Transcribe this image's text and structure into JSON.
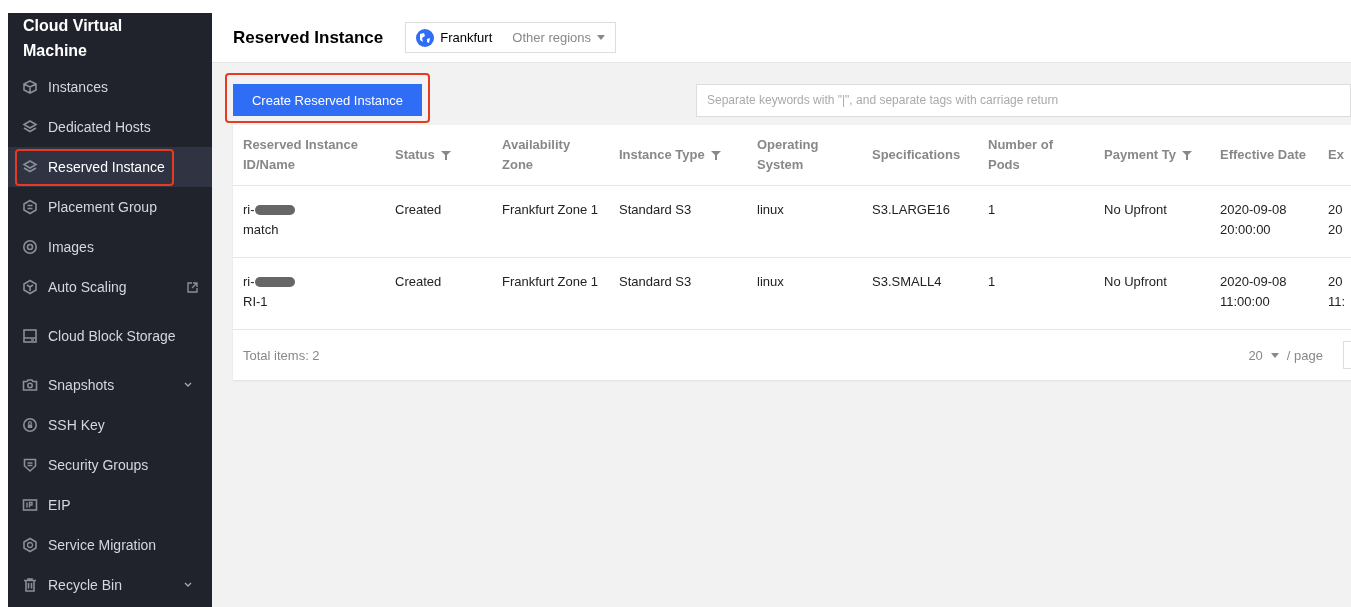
{
  "sidebar": {
    "title": "Cloud Virtual Machine",
    "items": [
      {
        "label": "Instances",
        "selected": false
      },
      {
        "label": "Dedicated Hosts",
        "selected": false
      },
      {
        "label": "Reserved Instance",
        "selected": true,
        "highlighted": true
      },
      {
        "label": "Placement Group",
        "selected": false
      },
      {
        "label": "Images",
        "selected": false
      },
      {
        "label": "Auto Scaling",
        "selected": false,
        "external": true
      },
      {
        "label": "Cloud Block Storage",
        "selected": false
      },
      {
        "label": "Snapshots",
        "selected": false,
        "expandable": true
      },
      {
        "label": "SSH Key",
        "selected": false
      },
      {
        "label": "Security Groups",
        "selected": false
      },
      {
        "label": "EIP",
        "selected": false
      },
      {
        "label": "Service Migration",
        "selected": false
      },
      {
        "label": "Recycle Bin",
        "selected": false,
        "expandable": true
      }
    ]
  },
  "header": {
    "title": "Reserved Instance",
    "region": "Frankfurt",
    "other_regions": "Other regions"
  },
  "toolbar": {
    "create_button": {
      "label": "Create Reserved Instance",
      "highlighted": true
    },
    "search": {
      "placeholder": "Separate keywords with \"|\", and separate tags with carriage return"
    }
  },
  "table": {
    "columns": [
      {
        "label": "Reserved Instance ID/Name",
        "filter": false
      },
      {
        "label": "Status",
        "filter": true
      },
      {
        "label": "Availability Zone",
        "filter": false
      },
      {
        "label": "Instance Type",
        "filter": true
      },
      {
        "label": "Operating System",
        "filter": false
      },
      {
        "label": "Specifications",
        "filter": false
      },
      {
        "label": "Number of Pods",
        "filter": false
      },
      {
        "label": "Payment Ty",
        "filter": true
      },
      {
        "label": "Effective Date",
        "filter": false
      },
      {
        "label": "Ex",
        "filter": false
      }
    ],
    "rows": [
      {
        "id": "ri-",
        "redacted": true,
        "name": "match",
        "status": "Created",
        "zone": "Frankfurt Zone 1",
        "type": "Standard S3",
        "os": "linux",
        "spec": "S3.LARGE16",
        "pods": "1",
        "payment": "No Upfront",
        "effective_date": "2020-09-08",
        "effective_time": "20:00:00",
        "column_10": [
          "20",
          "20"
        ]
      },
      {
        "id": "ri-",
        "redacted": true,
        "name": "RI-1",
        "status": "Created",
        "zone": "Frankfurt Zone 1",
        "type": "Standard S3",
        "os": "linux",
        "spec": "S3.SMALL4",
        "pods": "1",
        "payment": "No Upfront",
        "effective_date": "2020-09-08",
        "effective_time": "11:00:00",
        "column_10": [
          "20",
          "11:"
        ]
      }
    ],
    "total": "Total items:  2",
    "page_size": "20",
    "per_page": "/ page"
  }
}
